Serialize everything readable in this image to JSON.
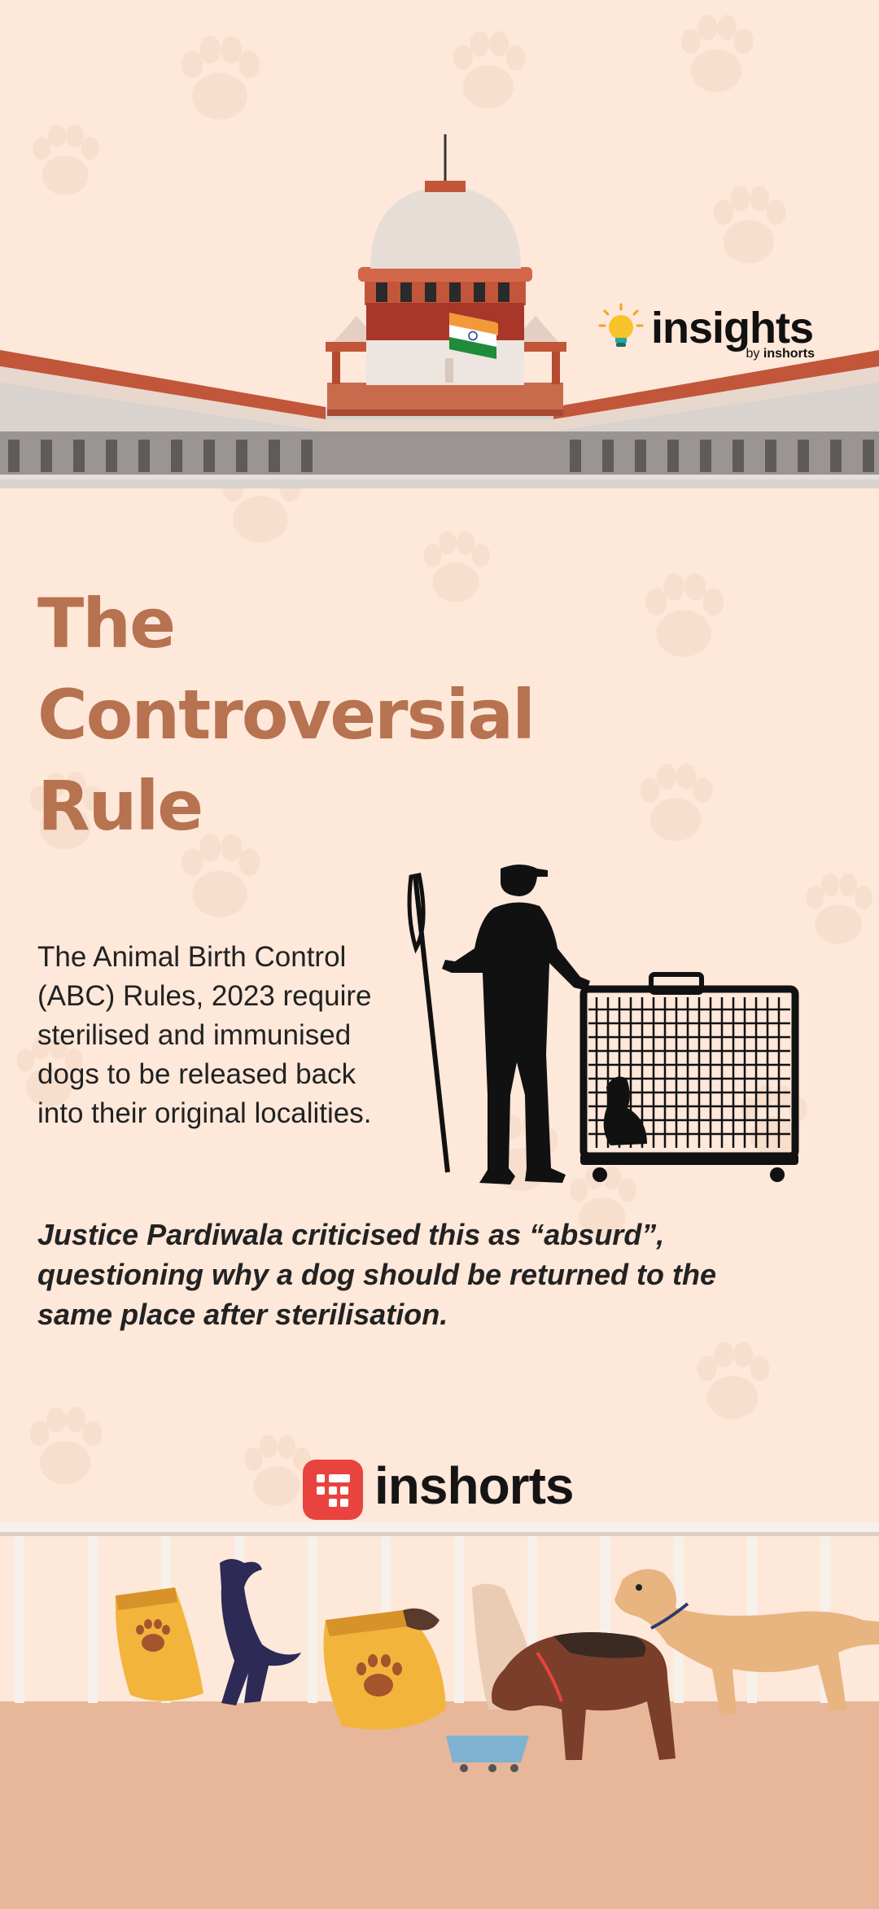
{
  "brand_top": {
    "name": "insights",
    "by_prefix": "by",
    "by_name": "inshorts"
  },
  "title_lines": [
    "The",
    "Controversial",
    "Rule"
  ],
  "body": "The Animal Birth Control (ABC) Rules, 2023 require sterilised and immunised dogs to be released back into their original localities.",
  "quote": "Justice Pardiwala criticised this as “absurd”, questioning why a dog should be returned to the same place after sterilisation.",
  "brand_bottom": {
    "name": "inshorts"
  },
  "colors": {
    "background": "#fde8da",
    "title": "#b77250",
    "text": "#222222",
    "brand_red": "#e8433e"
  },
  "icons": [
    "bulb-icon",
    "inshorts-logo-icon",
    "paw-icon"
  ]
}
